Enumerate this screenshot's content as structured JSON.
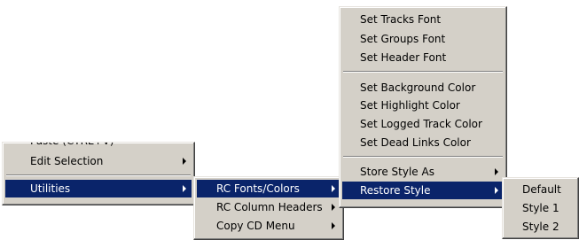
{
  "menu_main": {
    "items": [
      {
        "label": "Paste (CTRL+V)"
      },
      {
        "label": "Edit Selection"
      },
      {
        "label": "Utilities"
      }
    ]
  },
  "menu_utilities": {
    "items": [
      {
        "label": "RC Fonts/Colors"
      },
      {
        "label": "RC Column Headers"
      },
      {
        "label": "Copy CD Menu"
      }
    ]
  },
  "menu_fonts_colors": {
    "items": [
      {
        "label": "Set Tracks Font"
      },
      {
        "label": "Set Groups Font"
      },
      {
        "label": "Set Header Font"
      },
      {
        "label": "Set Background Color"
      },
      {
        "label": "Set Highlight Color"
      },
      {
        "label": "Set Logged Track Color"
      },
      {
        "label": "Set Dead Links Color"
      },
      {
        "label": "Store Style As"
      },
      {
        "label": "Restore Style"
      }
    ]
  },
  "menu_restore_style": {
    "items": [
      {
        "label": "Default"
      },
      {
        "label": "Style 1"
      },
      {
        "label": "Style 2"
      }
    ]
  },
  "colors": {
    "menu_bg": "#d4d0c8",
    "highlight": "#0a246a",
    "highlight_text": "#ffffff"
  }
}
